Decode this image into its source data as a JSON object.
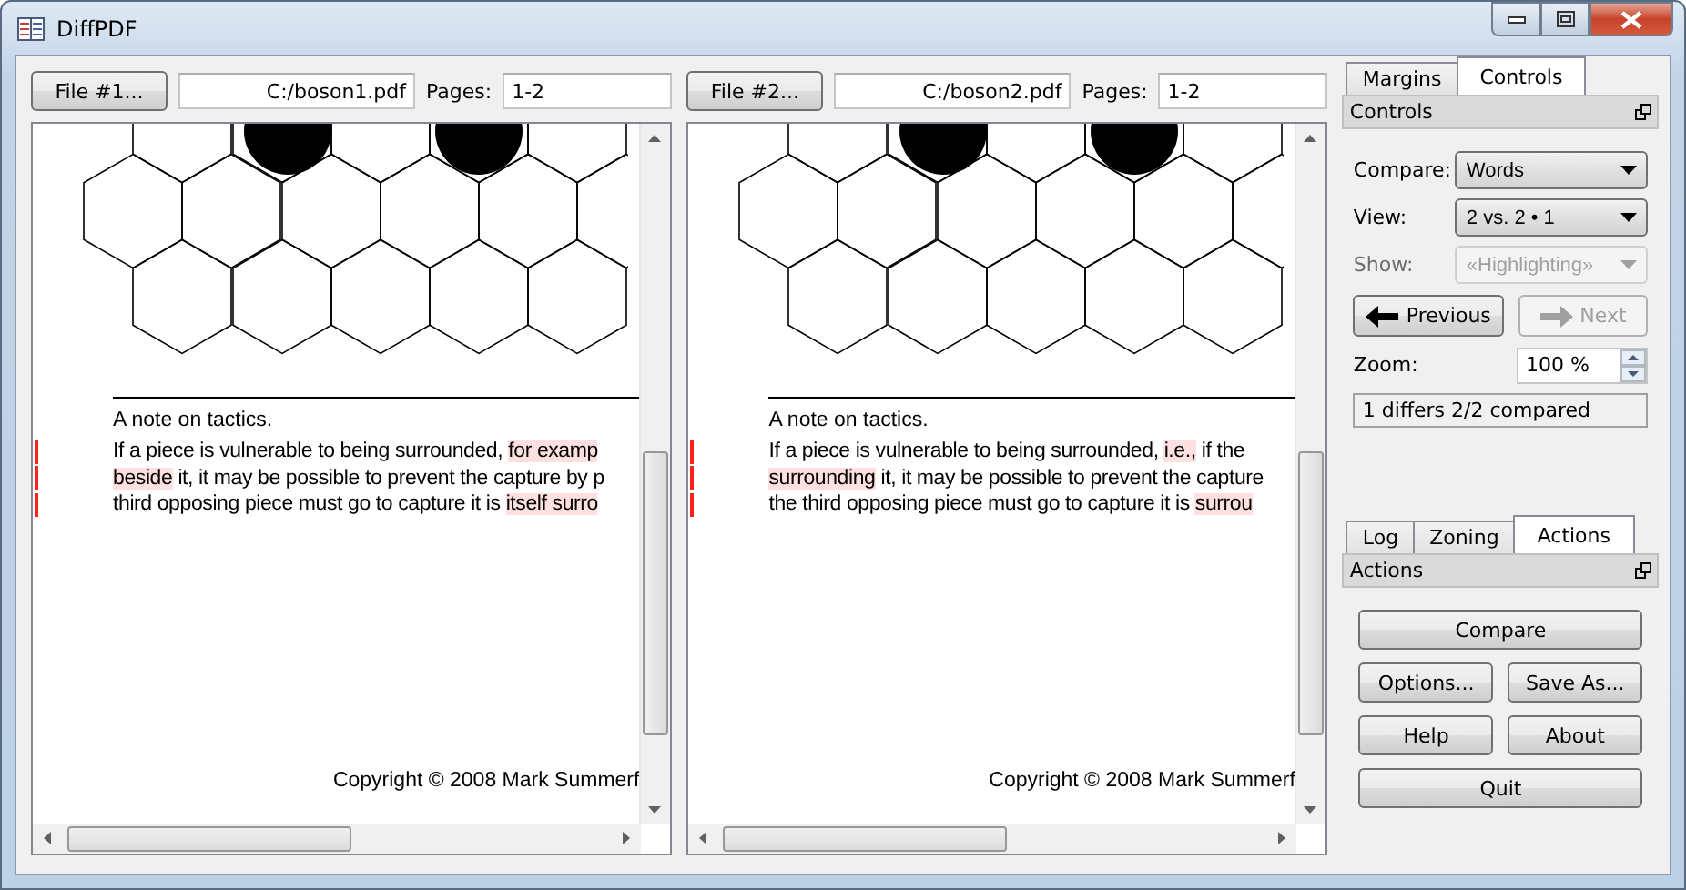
{
  "window": {
    "title": "DiffPDF"
  },
  "panes": [
    {
      "file_button": "File #1...",
      "path": "C:/boson1.pdf",
      "pages_label": "Pages:",
      "pages": "1-2",
      "heading": "A note on tactics.",
      "lines": [
        {
          "changed": true,
          "segments": [
            {
              "text": "If a piece is vulnerable to being surrounded, ",
              "highlighted": false
            },
            {
              "text": "for examp",
              "highlighted": true
            }
          ]
        },
        {
          "changed": true,
          "segments": [
            {
              "text": "beside",
              "highlighted": true
            },
            {
              "text": " it, it may be possible to prevent the capture by p",
              "highlighted": false
            }
          ]
        },
        {
          "changed": true,
          "segments": [
            {
              "text": "third opposing piece must go to capture it is ",
              "highlighted": false
            },
            {
              "text": "itself surro",
              "highlighted": true
            }
          ]
        }
      ],
      "footer": "Copyright © 2008 Mark Summerf"
    },
    {
      "file_button": "File #2...",
      "path": "C:/boson2.pdf",
      "pages_label": "Pages:",
      "pages": "1-2",
      "heading": "A note on tactics.",
      "lines": [
        {
          "changed": true,
          "segments": [
            {
              "text": "If a piece is vulnerable to being surrounded, ",
              "highlighted": false
            },
            {
              "text": "i.e.,",
              "highlighted": true
            },
            {
              "text": " if the",
              "highlighted": false
            }
          ]
        },
        {
          "changed": true,
          "segments": [
            {
              "text": "surrounding",
              "highlighted": true
            },
            {
              "text": " it, it may be possible to prevent the capture",
              "highlighted": false
            }
          ]
        },
        {
          "changed": true,
          "segments": [
            {
              "text": "the third opposing piece must go to capture it is ",
              "highlighted": false
            },
            {
              "text": "surrou",
              "highlighted": true
            }
          ]
        }
      ],
      "footer": "Copyright © 2008 Mark Summerf"
    }
  ],
  "controls_dock": {
    "tabs": [
      {
        "label": "Margins",
        "selected": false
      },
      {
        "label": "Controls",
        "selected": true
      }
    ],
    "title": "Controls",
    "fields": [
      {
        "label": "Compare:",
        "value": "Words",
        "disabled": false
      },
      {
        "label": "View:",
        "value": "2 vs. 2 • 1",
        "disabled": false
      },
      {
        "label": "Show:",
        "value": "«Highlighting»",
        "disabled": true
      }
    ],
    "nav_buttons": [
      {
        "label": "Previous",
        "kind": "back",
        "disabled": false
      },
      {
        "label": "Next",
        "kind": "forward",
        "disabled": true
      }
    ],
    "zoom": {
      "label": "Zoom:",
      "value": "100 %"
    },
    "status": "1 differs 2/2 compared"
  },
  "actions_dock": {
    "tabs": [
      {
        "label": "Log",
        "selected": false
      },
      {
        "label": "Zoning",
        "selected": false
      },
      {
        "label": "Actions",
        "selected": true
      }
    ],
    "title": "Actions",
    "button_rows": [
      [
        "Compare"
      ],
      [
        "Options...",
        "Save As..."
      ],
      [
        "Help",
        "About"
      ],
      [
        "Quit"
      ]
    ]
  }
}
